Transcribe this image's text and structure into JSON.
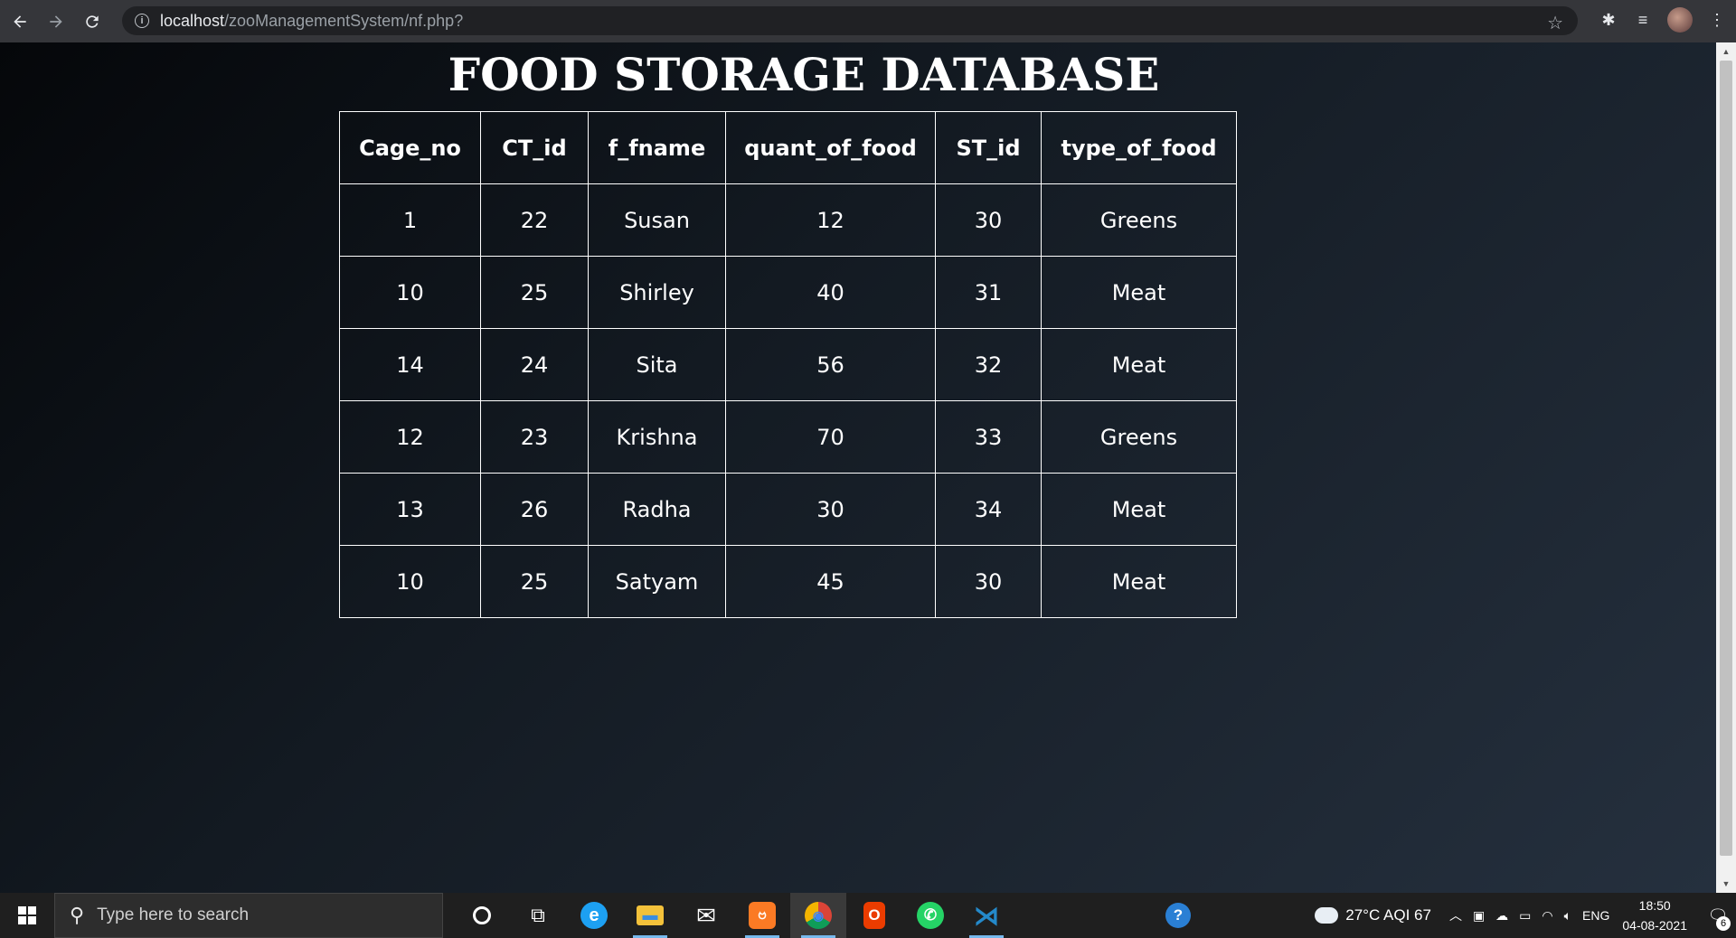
{
  "browser": {
    "url_host": "localhost",
    "url_path": "/zooManagementSystem/nf.php?"
  },
  "page": {
    "title": "FOOD STORAGE DATABASE",
    "table": {
      "headers": [
        "Cage_no",
        "CT_id",
        "f_fname",
        "quant_of_food",
        "ST_id",
        "type_of_food"
      ],
      "rows": [
        [
          "1",
          "22",
          "Susan",
          "12",
          "30",
          "Greens"
        ],
        [
          "10",
          "25",
          "Shirley",
          "40",
          "31",
          "Meat"
        ],
        [
          "14",
          "24",
          "Sita",
          "56",
          "32",
          "Meat"
        ],
        [
          "12",
          "23",
          "Krishna",
          "70",
          "33",
          "Greens"
        ],
        [
          "13",
          "26",
          "Radha",
          "30",
          "34",
          "Meat"
        ],
        [
          "10",
          "25",
          "Satyam",
          "45",
          "30",
          "Meat"
        ]
      ]
    }
  },
  "taskbar": {
    "search_placeholder": "Type here to search",
    "weather": "27°C  AQI 67",
    "language": "ENG",
    "time": "18:50",
    "date": "04-08-2021",
    "notification_count": "6",
    "apps": [
      {
        "icon": "cortana-icon",
        "label": "O"
      },
      {
        "icon": "task-view-icon",
        "label": "⧉"
      },
      {
        "icon": "edge-icon",
        "label": "e"
      },
      {
        "icon": "file-explorer-icon",
        "label": "▬"
      },
      {
        "icon": "mail-icon",
        "label": "✉"
      },
      {
        "icon": "xampp-icon",
        "label": "ဗ"
      },
      {
        "icon": "chrome-icon",
        "label": "◉"
      },
      {
        "icon": "office-icon",
        "label": "O"
      },
      {
        "icon": "whatsapp-icon",
        "label": "✆"
      },
      {
        "icon": "vscode-icon",
        "label": "⋊"
      },
      {
        "icon": "help-icon",
        "label": "?"
      }
    ]
  },
  "colors": {
    "page_bg_start": "#05070a",
    "page_bg_end": "#25303e",
    "text": "#ffffff",
    "edge_blue": "#1da0f2",
    "xampp_orange": "#fb7a24",
    "office_red": "#eb3c00",
    "whatsapp_green": "#25d366",
    "vscode_blue": "#2489ca"
  }
}
